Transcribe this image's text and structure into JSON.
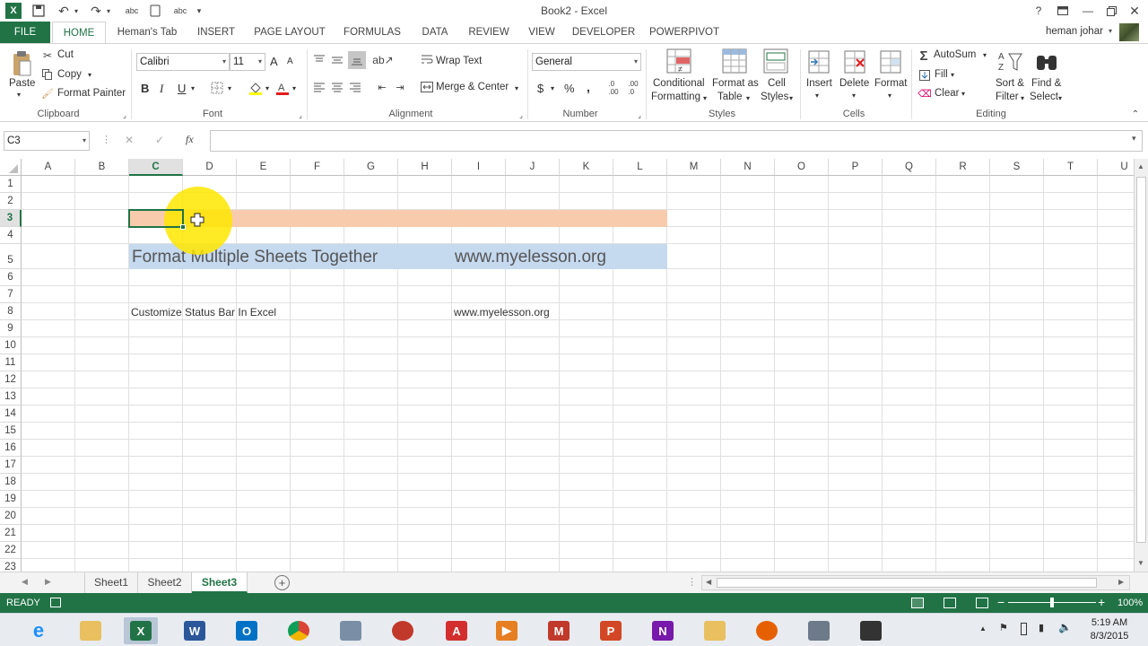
{
  "titlebar": {
    "title": "Book2 - Excel",
    "help": "?"
  },
  "tabs": [
    {
      "label": "FILE"
    },
    {
      "label": "HOME"
    },
    {
      "label": "Heman's Tab"
    },
    {
      "label": "INSERT"
    },
    {
      "label": "PAGE LAYOUT"
    },
    {
      "label": "FORMULAS"
    },
    {
      "label": "DATA"
    },
    {
      "label": "REVIEW"
    },
    {
      "label": "VIEW"
    },
    {
      "label": "DEVELOPER"
    },
    {
      "label": "POWERPIVOT"
    }
  ],
  "user": {
    "name": "heman johar"
  },
  "ribbon": {
    "clipboard": {
      "paste": "Paste",
      "cut": "Cut",
      "copy": "Copy",
      "format_painter": "Format Painter",
      "label": "Clipboard"
    },
    "font": {
      "name": "Calibri",
      "size": "11",
      "bold": "B",
      "italic": "I",
      "underline": "U",
      "label": "Font",
      "grow": "A",
      "shrink": "A"
    },
    "alignment": {
      "wrap": "Wrap Text",
      "merge": "Merge & Center",
      "label": "Alignment"
    },
    "number": {
      "format": "General",
      "currency": "$",
      "percent": "%",
      "comma": ",",
      "label": "Number"
    },
    "styles": {
      "conditional_1": "Conditional",
      "conditional_2": "Formatting",
      "table_1": "Format as",
      "table_2": "Table",
      "cell_1": "Cell",
      "cell_2": "Styles",
      "label": "Styles"
    },
    "cells": {
      "insert": "Insert",
      "delete": "Delete",
      "format": "Format",
      "label": "Cells"
    },
    "editing": {
      "autosum": "AutoSum",
      "fill": "Fill",
      "clear": "Clear",
      "sort_1": "Sort &",
      "sort_2": "Filter",
      "find_1": "Find &",
      "find_2": "Select",
      "label": "Editing"
    }
  },
  "formula_bar": {
    "name_box": "C3",
    "fx": "fx",
    "cancel": "✕",
    "enter": "✓",
    "content": ""
  },
  "grid": {
    "columns": [
      "A",
      "B",
      "C",
      "D",
      "E",
      "F",
      "G",
      "H",
      "I",
      "J",
      "K",
      "L",
      "M",
      "N",
      "O",
      "P",
      "Q",
      "R",
      "S",
      "T",
      "U"
    ],
    "rows": [
      "1",
      "2",
      "3",
      "4",
      "5",
      "6",
      "7",
      "8",
      "9",
      "10",
      "11",
      "12",
      "13",
      "14",
      "15",
      "16",
      "17",
      "18",
      "19",
      "20",
      "21",
      "22",
      "23"
    ],
    "selected_cell": "C3",
    "cells": {
      "c5": "Format Multiple Sheets Together",
      "i5": "www.myelesson.org",
      "c8": "Customize Status Bar In Excel",
      "i8": "www.myelesson.org"
    }
  },
  "sheets": [
    {
      "label": "Sheet1"
    },
    {
      "label": "Sheet2"
    },
    {
      "label": "Sheet3"
    }
  ],
  "status": {
    "mode": "READY",
    "zoom": "100%"
  },
  "taskbar": {
    "time": "5:19 AM",
    "date": "8/3/2015"
  },
  "colors": {
    "accent": "#217346",
    "orange_fill": "#f8cbad",
    "blue_fill": "#c5d9ef"
  }
}
